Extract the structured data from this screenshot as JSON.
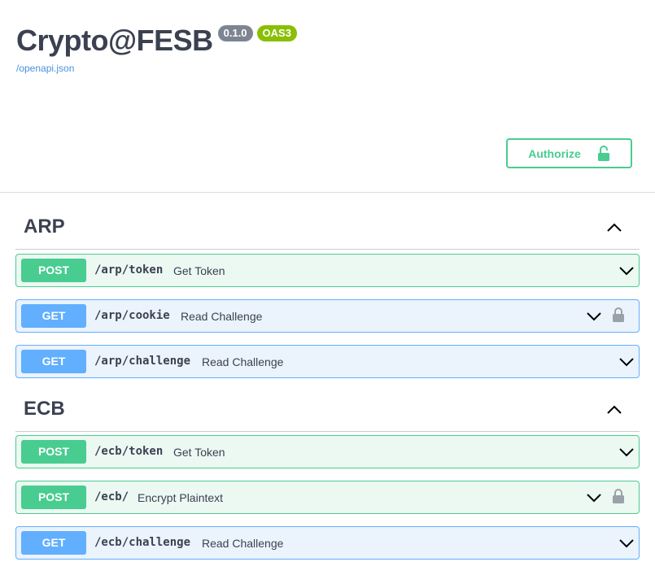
{
  "app": {
    "title": "Crypto@FESB",
    "version": "0.1.0",
    "oas": "OAS3",
    "spec_link": "/openapi.json"
  },
  "authorize": {
    "label": "Authorize",
    "icon": "lock-open-icon"
  },
  "colors": {
    "post": "#49cc90",
    "get": "#61affe",
    "text": "#3b4151"
  },
  "sections": [
    {
      "name": "ARP",
      "operations": [
        {
          "method": "POST",
          "path": "/arp/token",
          "summary": "Get Token",
          "locked": false
        },
        {
          "method": "GET",
          "path": "/arp/cookie",
          "summary": "Read Challenge",
          "locked": true
        },
        {
          "method": "GET",
          "path": "/arp/challenge",
          "summary": "Read Challenge",
          "locked": false
        }
      ]
    },
    {
      "name": "ECB",
      "operations": [
        {
          "method": "POST",
          "path": "/ecb/token",
          "summary": "Get Token",
          "locked": false
        },
        {
          "method": "POST",
          "path": "/ecb/",
          "summary": "Encrypt Plaintext",
          "locked": true
        },
        {
          "method": "GET",
          "path": "/ecb/challenge",
          "summary": "Read Challenge",
          "locked": false
        }
      ]
    }
  ]
}
